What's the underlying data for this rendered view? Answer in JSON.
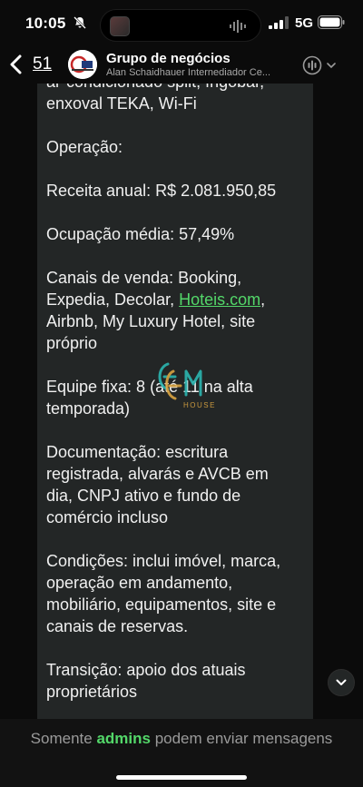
{
  "status_bar": {
    "time": "10:05",
    "network": "5G",
    "icons": [
      "bell-slash-icon",
      "signal-icon",
      "battery-icon"
    ]
  },
  "header": {
    "back_count": "51",
    "title": "Grupo de negócios",
    "subtitle": "Alan Schaidhauer Internediador Ce...",
    "icons": [
      "chevron-left-icon",
      "group-avatar",
      "call-icon",
      "chevron-down-icon"
    ]
  },
  "message": {
    "lines": [
      "ar-condicionado split, frigobar,",
      "enxoval TEKA, Wi-Fi",
      "",
      "Operação:",
      "",
      "Receita anual: R$ 2.081.950,85",
      "",
      "Ocupação média: 57,49%",
      "",
      "Canais de venda: Booking,",
      "Expedia, Decolar, ",
      "Airbnb, My Luxury Hotel, site",
      "próprio",
      "",
      "Equipe fixa: 8 (até 11 na alta",
      "temporada)",
      "",
      "Documentação: escritura",
      "registrada, alvarás e AVCB em",
      "dia, CNPJ ativo e fundo de",
      "comércio incluso",
      "",
      "Condições: inclui imóvel, marca,",
      "operação em andamento,",
      "mobiliário, equipamentos, site e",
      "canais de reservas.",
      "",
      "Transição: apoio dos atuais",
      "proprietários"
    ],
    "link_text": "Hoteis.com",
    "link_suffix": ",",
    "watermark_text": "HOUSE"
  },
  "footer": {
    "notice_prefix": "Somente ",
    "notice_highlight": "admins",
    "notice_suffix": " podem enviar mensagens"
  },
  "colors": {
    "background": "#0b0b0b",
    "bubble": "#232626",
    "accent_green": "#53d769",
    "muted_text": "#9a9a9a"
  }
}
